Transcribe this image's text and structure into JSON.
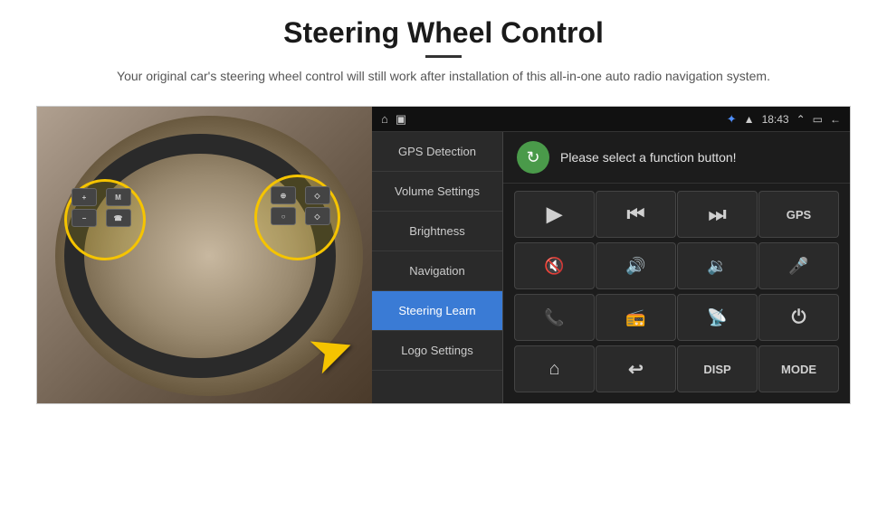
{
  "header": {
    "title": "Steering Wheel Control",
    "divider": true,
    "subtitle": "Your original car's steering wheel control will still work after installation of this all-in-one auto radio navigation system."
  },
  "status_bar": {
    "left_icons": [
      "home",
      "image"
    ],
    "bluetooth": "BT",
    "signal": "▲",
    "time": "18:43",
    "chevron": "⌃",
    "window": "▭",
    "back": "←"
  },
  "menu": {
    "items": [
      {
        "id": "gps-detection",
        "label": "GPS Detection",
        "active": false
      },
      {
        "id": "volume-settings",
        "label": "Volume Settings",
        "active": false
      },
      {
        "id": "brightness",
        "label": "Brightness",
        "active": false
      },
      {
        "id": "navigation",
        "label": "Navigation",
        "active": false
      },
      {
        "id": "steering-learn",
        "label": "Steering Learn",
        "active": true
      },
      {
        "id": "logo-settings",
        "label": "Logo Settings",
        "active": false
      }
    ]
  },
  "function_panel": {
    "header_text": "Please select a function button!",
    "refresh_icon": "↻",
    "buttons": [
      {
        "id": "play",
        "type": "icon",
        "icon": "▶",
        "label": "play"
      },
      {
        "id": "prev",
        "type": "icon",
        "icon": "⏮",
        "label": "previous"
      },
      {
        "id": "next",
        "type": "icon",
        "icon": "⏭",
        "label": "next"
      },
      {
        "id": "gps",
        "type": "text",
        "text": "GPS",
        "label": "gps"
      },
      {
        "id": "mute",
        "type": "icon",
        "icon": "🔇",
        "label": "mute"
      },
      {
        "id": "vol-up",
        "type": "icon",
        "icon": "🔊+",
        "label": "volume-up"
      },
      {
        "id": "vol-down",
        "type": "icon",
        "icon": "🔉−",
        "label": "volume-down"
      },
      {
        "id": "mic",
        "type": "icon",
        "icon": "🎤",
        "label": "microphone"
      },
      {
        "id": "phone",
        "type": "icon",
        "icon": "📞",
        "label": "phone"
      },
      {
        "id": "radio",
        "type": "icon",
        "icon": "📻",
        "label": "radio-tune"
      },
      {
        "id": "radio2",
        "type": "icon",
        "icon": "📡",
        "label": "radio2"
      },
      {
        "id": "power",
        "type": "icon",
        "icon": "⏻",
        "label": "power"
      },
      {
        "id": "home",
        "type": "icon",
        "icon": "⌂",
        "label": "home"
      },
      {
        "id": "back2",
        "type": "icon",
        "icon": "↩",
        "label": "back"
      },
      {
        "id": "disp",
        "type": "text",
        "text": "DISP",
        "label": "display"
      },
      {
        "id": "mode",
        "type": "text",
        "text": "MODE",
        "label": "mode"
      }
    ]
  },
  "arrow": "➤",
  "colors": {
    "active_menu": "#3a7bd5",
    "bg_dark": "#1c1c1c",
    "bg_medium": "#2a2a2a",
    "text_light": "#e0e0e0",
    "accent_yellow": "#f5c400",
    "green_btn": "#4a9a4a"
  }
}
